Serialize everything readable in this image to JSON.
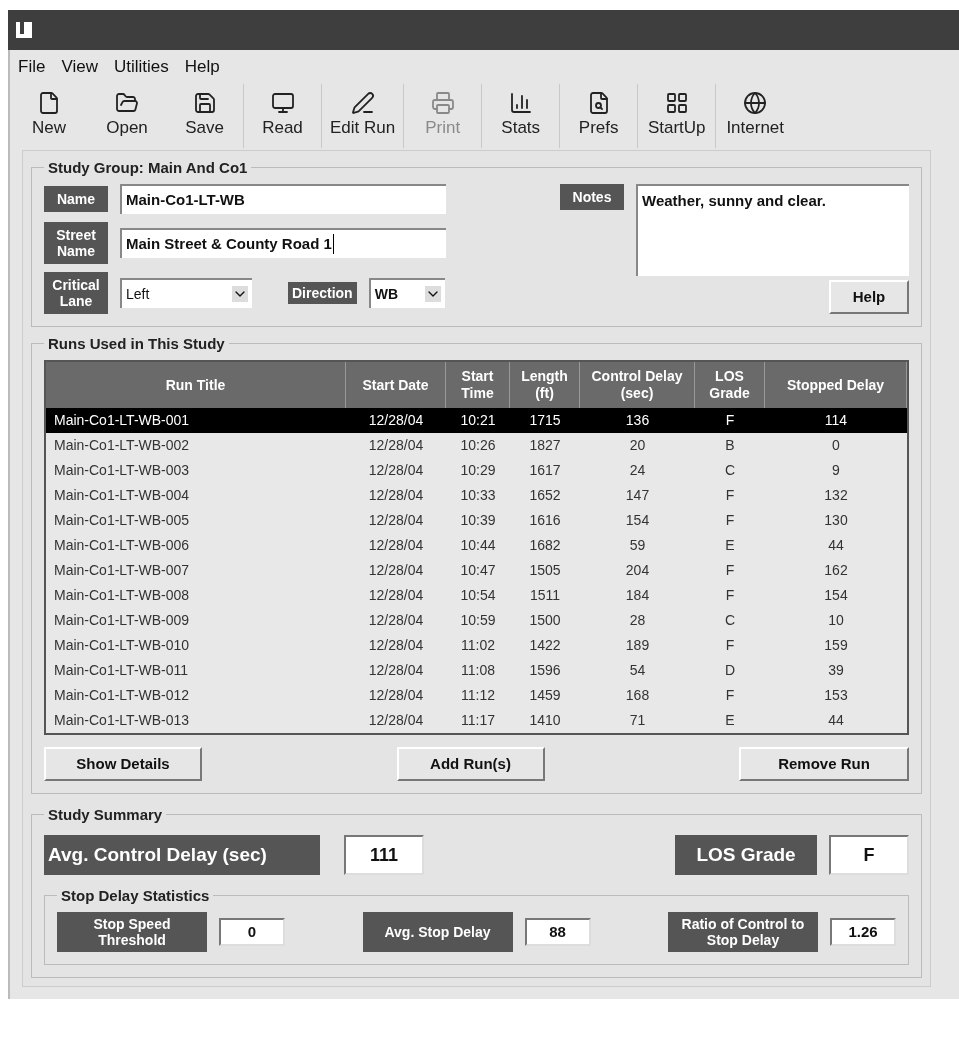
{
  "menu": [
    "File",
    "View",
    "Utilities",
    "Help"
  ],
  "toolbar": [
    {
      "label": "New",
      "kind": "new",
      "disabled": false
    },
    {
      "label": "Open",
      "kind": "open",
      "disabled": false
    },
    {
      "label": "Save",
      "kind": "save",
      "disabled": false
    },
    {
      "label": "Read",
      "kind": "read",
      "disabled": false
    },
    {
      "label": "Edit Run",
      "kind": "edit",
      "disabled": false
    },
    {
      "label": "Print",
      "kind": "print",
      "disabled": true
    },
    {
      "label": "Stats",
      "kind": "stats",
      "disabled": false
    },
    {
      "label": "Prefs",
      "kind": "prefs",
      "disabled": false
    },
    {
      "label": "StartUp",
      "kind": "startup",
      "disabled": false
    },
    {
      "label": "Internet",
      "kind": "internet",
      "disabled": false
    }
  ],
  "study_group": {
    "title": "Study Group: Main And Co1",
    "name_label": "Name",
    "name": "Main-Co1-LT-WB",
    "street_label": "Street Name",
    "street": "Main Street & County Road 1",
    "notes_label": "Notes",
    "notes": "Weather, sunny and clear.",
    "lane_label": "Critical Lane",
    "lane": "Left",
    "direction_label": "Direction",
    "direction": "WB",
    "help": "Help"
  },
  "runs": {
    "title": "Runs Used in This Study",
    "columns": [
      "Run Title",
      "Start Date",
      "Start Time",
      "Length (ft)",
      "Control Delay (sec)",
      "LOS Grade",
      "Stopped Delay"
    ],
    "rows": [
      {
        "cells": [
          "Main-Co1-LT-WB-001",
          "12/28/04",
          "10:21",
          "1715",
          "136",
          "F",
          "114"
        ],
        "selected": true
      },
      {
        "cells": [
          "Main-Co1-LT-WB-002",
          "12/28/04",
          "10:26",
          "1827",
          "20",
          "B",
          "0"
        ],
        "selected": false
      },
      {
        "cells": [
          "Main-Co1-LT-WB-003",
          "12/28/04",
          "10:29",
          "1617",
          "24",
          "C",
          "9"
        ],
        "selected": false
      },
      {
        "cells": [
          "Main-Co1-LT-WB-004",
          "12/28/04",
          "10:33",
          "1652",
          "147",
          "F",
          "132"
        ],
        "selected": false
      },
      {
        "cells": [
          "Main-Co1-LT-WB-005",
          "12/28/04",
          "10:39",
          "1616",
          "154",
          "F",
          "130"
        ],
        "selected": false
      },
      {
        "cells": [
          "Main-Co1-LT-WB-006",
          "12/28/04",
          "10:44",
          "1682",
          "59",
          "E",
          "44"
        ],
        "selected": false
      },
      {
        "cells": [
          "Main-Co1-LT-WB-007",
          "12/28/04",
          "10:47",
          "1505",
          "204",
          "F",
          "162"
        ],
        "selected": false
      },
      {
        "cells": [
          "Main-Co1-LT-WB-008",
          "12/28/04",
          "10:54",
          "1511",
          "184",
          "F",
          "154"
        ],
        "selected": false
      },
      {
        "cells": [
          "Main-Co1-LT-WB-009",
          "12/28/04",
          "10:59",
          "1500",
          "28",
          "C",
          "10"
        ],
        "selected": false
      },
      {
        "cells": [
          "Main-Co1-LT-WB-010",
          "12/28/04",
          "11:02",
          "1422",
          "189",
          "F",
          "159"
        ],
        "selected": false
      },
      {
        "cells": [
          "Main-Co1-LT-WB-011",
          "12/28/04",
          "11:08",
          "1596",
          "54",
          "D",
          "39"
        ],
        "selected": false
      },
      {
        "cells": [
          "Main-Co1-LT-WB-012",
          "12/28/04",
          "11:12",
          "1459",
          "168",
          "F",
          "153"
        ],
        "selected": false
      },
      {
        "cells": [
          "Main-Co1-LT-WB-013",
          "12/28/04",
          "11:17",
          "1410",
          "71",
          "E",
          "44"
        ],
        "selected": false
      }
    ],
    "buttons": [
      "Show Details",
      "Add Run(s)",
      "Remove Run"
    ]
  },
  "summary": {
    "title": "Study Summary",
    "avg_label": "Avg. Control Delay (sec)",
    "avg": "111",
    "los_label": "LOS Grade",
    "los": "F",
    "stop_title": "Stop Delay Statistics",
    "stats": [
      {
        "label": "Stop Speed Threshold",
        "value": "0"
      },
      {
        "label": "Avg. Stop Delay",
        "value": "88"
      },
      {
        "label": "Ratio of Control to Stop Delay",
        "value": "1.26"
      }
    ]
  }
}
